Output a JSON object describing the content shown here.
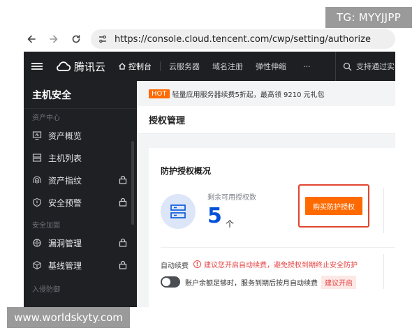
{
  "watermarks": {
    "top_right": "TG: MYYJJPP",
    "bottom_left": "www.worldskyty.com"
  },
  "browser": {
    "url": "https://console.cloud.tencent.com/cwp/setting/authorize",
    "icons": [
      "back-icon",
      "forward-icon",
      "reload-icon",
      "site-settings-icon"
    ]
  },
  "topbar": {
    "logo_text": "腾讯云",
    "items": [
      "控制台",
      "云服务器",
      "域名注册",
      "弹性伸缩",
      "···"
    ],
    "search_placeholder": "支持通过实例"
  },
  "sidebar": {
    "title": "主机安全",
    "sections": [
      {
        "label": "资产中心",
        "items": [
          {
            "label": "资产概览",
            "icon": "monitor-icon",
            "locked": false
          },
          {
            "label": "主机列表",
            "icon": "server-list-icon",
            "locked": false
          },
          {
            "label": "资产指纹",
            "icon": "fingerprint-icon",
            "locked": true
          },
          {
            "label": "安全预警",
            "icon": "shield-alert-icon",
            "locked": true
          }
        ]
      },
      {
        "label": "安全加固",
        "items": [
          {
            "label": "漏洞管理",
            "icon": "bug-icon",
            "locked": true
          },
          {
            "label": "基线管理",
            "icon": "cube-icon",
            "locked": true
          }
        ]
      },
      {
        "label": "入侵防御",
        "items": []
      }
    ]
  },
  "notice": {
    "badge": "HOT",
    "text": "轻量应用服务器续费5折起，最高领 9210 元礼包"
  },
  "page": {
    "title": "授权管理"
  },
  "card": {
    "title": "防护授权概况",
    "remain_label": "剩余可用授权数",
    "remain_value": "5",
    "remain_unit": "个",
    "buy_button": "购买防护授权",
    "renew_label": "自动续费",
    "renew_warning": "建议您开启自动续费，避免授权到期终止安全防护",
    "toggle_text": "账户余额足够时，服务到期后按月自动续费",
    "toggle_on": false,
    "suggest_badge": "建议开启"
  },
  "colors": {
    "accent": "#0052d9",
    "orange": "#ff6a00",
    "danger": "#e54545",
    "dark_bg": "#1e1f22"
  }
}
